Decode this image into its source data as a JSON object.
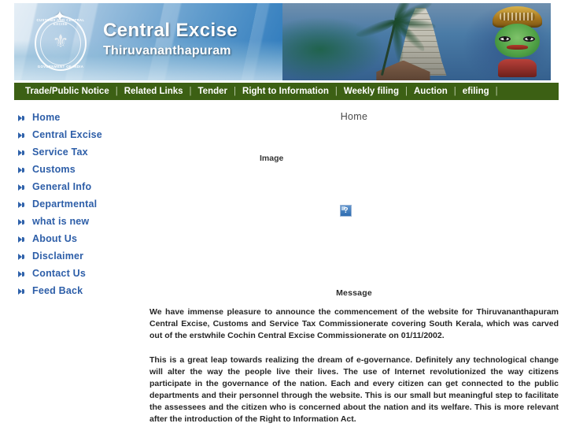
{
  "banner": {
    "title": "Central Excise",
    "subtitle": "Thiruvananthapuram",
    "emblem_top_text": "CUSTOMS AND CENTRAL EXCISE",
    "emblem_bottom_text": "GOVERNMENT OF INDIA",
    "emblem_symbol": "⚜"
  },
  "topnav": {
    "items": [
      {
        "label": "Trade/Public Notice"
      },
      {
        "label": "Related Links"
      },
      {
        "label": "Tender"
      },
      {
        "label": "Right to Information"
      },
      {
        "label": "Weekly filing"
      },
      {
        "label": "Auction"
      },
      {
        "label": "efiling"
      }
    ],
    "separator": "|"
  },
  "sidebar": {
    "items": [
      {
        "label": "Home",
        "icon": "arrow-bullet-icon"
      },
      {
        "label": "Central Excise",
        "icon": "arrow-bullet-icon"
      },
      {
        "label": "Service Tax",
        "icon": "arrow-bullet-icon"
      },
      {
        "label": "Customs",
        "icon": "arrow-bullet-icon"
      },
      {
        "label": "General Info",
        "icon": "arrow-bullet-icon"
      },
      {
        "label": "Departmental",
        "icon": "arrow-bullet-icon"
      },
      {
        "label": "what is new",
        "icon": "arrow-bullet-icon"
      },
      {
        "label": "About Us",
        "icon": "arrow-bullet-icon"
      },
      {
        "label": "Disclaimer",
        "icon": "arrow-bullet-icon"
      },
      {
        "label": "Contact Us",
        "icon": "arrow-bullet-icon"
      },
      {
        "label": "Feed Back",
        "icon": "arrow-bullet-icon"
      }
    ]
  },
  "main": {
    "page_title": "Home",
    "image_alt_text": "Image",
    "broken_image_glyph": "?",
    "message_heading": "Message",
    "paragraphs": [
      "We have immense pleasure to announce the commencement of the website for  Thiruvananthapuram Central Excise, Customs and Service Tax Commissionerate covering South Kerala, which was carved out of the erstwhile Cochin Central Excise Commissionerate on 01/11/2002.",
      "This is a great leap towards realizing the dream of e-governance. Definitely any technological change will alter the way the people live their lives. The use of Internet revolutionized the way citizens participate in the governance of the nation. Each and every citizen can get connected to the public departments and their personnel through the website. This is our small but meaningful step to facilitate the assessees and the citizen who is concerned about the nation and its welfare. This is more relevant after the introduction of the Right to Information Act."
    ]
  },
  "colors": {
    "nav_green": "#3c6014",
    "sidebar_link_blue": "#2d5ea8",
    "banner_blue": "#2f7bbd",
    "page_background": "#ffffff"
  }
}
